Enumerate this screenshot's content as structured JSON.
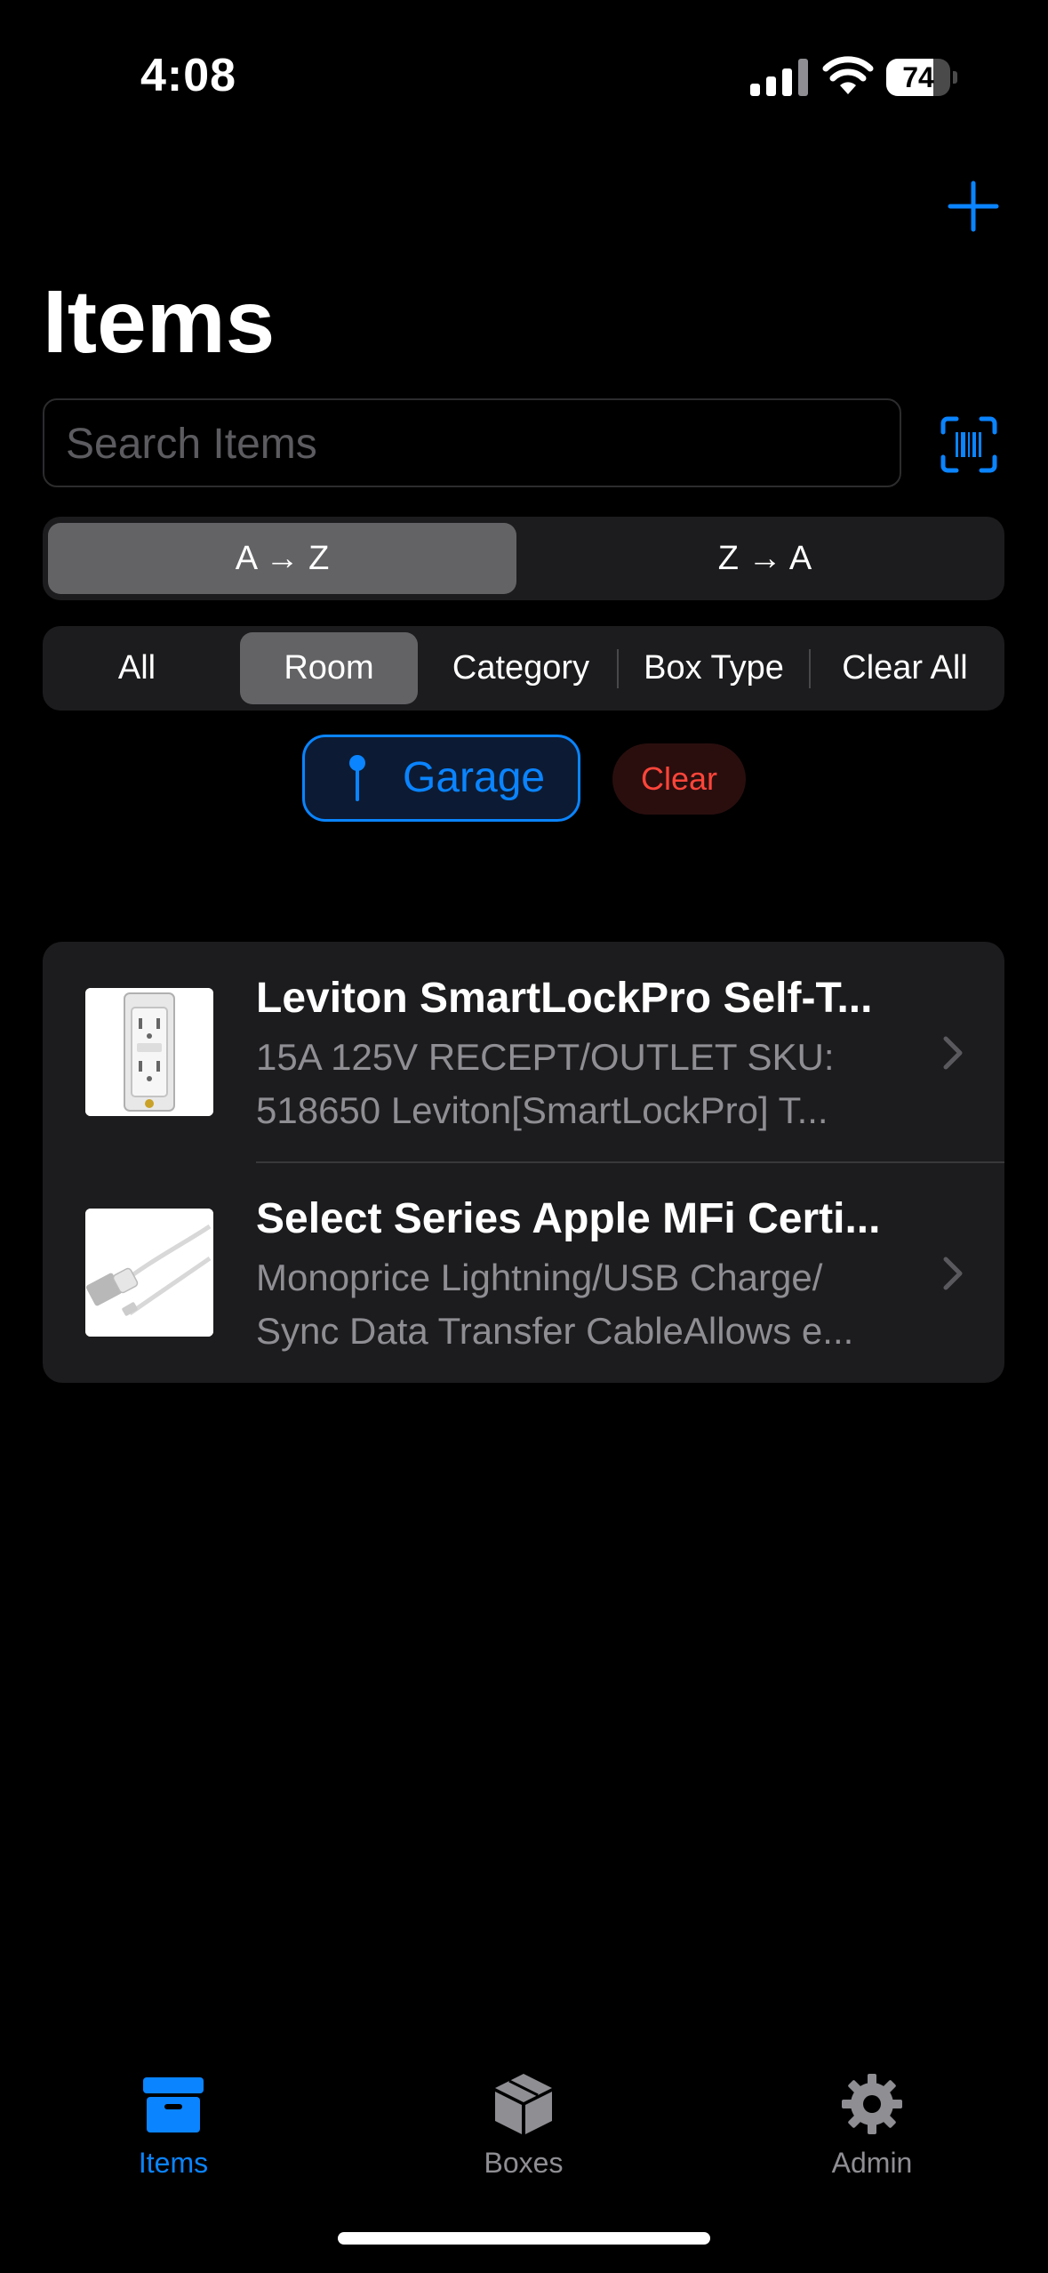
{
  "status_bar": {
    "time": "4:08",
    "battery": "74",
    "battery_level": 0.74
  },
  "header": {
    "title": "Items",
    "add_icon": "plus-icon"
  },
  "search": {
    "placeholder": "Search Items",
    "value": "",
    "scan_icon": "barcode-scan-icon"
  },
  "sort": {
    "options": [
      "A → Z",
      "Z → A"
    ],
    "selected": "A → Z"
  },
  "filters": {
    "options": [
      "All",
      "Room",
      "Category",
      "Box Type",
      "Clear All"
    ],
    "selected": "Room"
  },
  "active_filter": {
    "label": "Garage",
    "icon": "pin-icon",
    "clear_label": "Clear"
  },
  "items": [
    {
      "title": "Leviton SmartLockPro Self-T...",
      "line1": "15A 125V RECEPT/OUTLET SKU:",
      "line2": "518650 Leviton[SmartLockPro] T...",
      "thumb": "outlet-thumbnail"
    },
    {
      "title": "Select Series Apple MFi Certi...",
      "line1": "Monoprice Lightning/USB Charge/",
      "line2": "Sync Data Transfer CableAllows e...",
      "thumb": "cable-thumbnail"
    }
  ],
  "tabbar": {
    "tabs": [
      {
        "label": "Items",
        "icon": "archivebox-icon",
        "active": true
      },
      {
        "label": "Boxes",
        "icon": "cube-box-icon",
        "active": false
      },
      {
        "label": "Admin",
        "icon": "gear-icon",
        "active": false
      }
    ]
  },
  "colors": {
    "accent": "#0a84ff",
    "destructive": "#ff453a",
    "inactive": "#8e8e93",
    "card": "#1c1c1e"
  }
}
